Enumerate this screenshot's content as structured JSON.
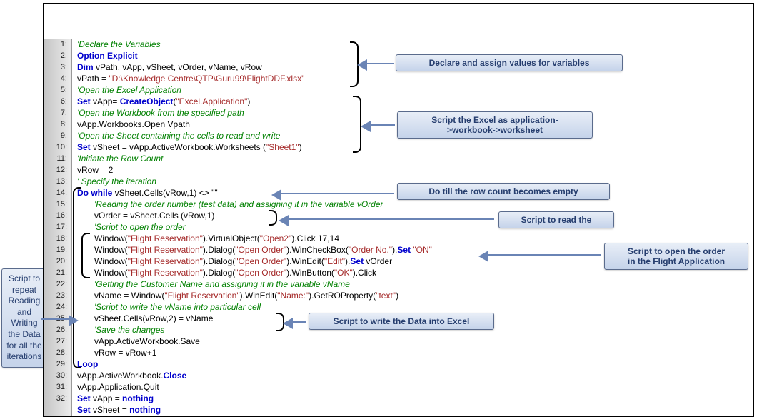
{
  "code": {
    "lines": [
      {
        "n": "1:",
        "indent": 0,
        "segs": [
          {
            "t": "'Declare the Variables",
            "c": "comment"
          }
        ]
      },
      {
        "n": "2:",
        "indent": 0,
        "segs": [
          {
            "t": "Option Explicit",
            "c": "kw"
          }
        ]
      },
      {
        "n": "3:",
        "indent": 0,
        "segs": [
          {
            "t": "Dim ",
            "c": "kw"
          },
          {
            "t": "vPath, vApp, vSheet, vOrder, vName, vRow",
            "c": "plain"
          }
        ]
      },
      {
        "n": "4:",
        "indent": 0,
        "segs": [
          {
            "t": "vPath = ",
            "c": "plain"
          },
          {
            "t": "\"D:\\Knowledge Centre\\QTP\\Guru99\\FlightDDF.xlsx\"",
            "c": "str"
          }
        ]
      },
      {
        "n": "5:",
        "indent": 0,
        "segs": [
          {
            "t": "'Open the Excel Application",
            "c": "comment"
          }
        ]
      },
      {
        "n": "6:",
        "indent": 0,
        "segs": [
          {
            "t": "Set ",
            "c": "kw"
          },
          {
            "t": "vApp= ",
            "c": "plain"
          },
          {
            "t": "CreateObject",
            "c": "kw"
          },
          {
            "t": "(",
            "c": "plain"
          },
          {
            "t": "\"Excel.Application\"",
            "c": "str"
          },
          {
            "t": ")",
            "c": "plain"
          }
        ]
      },
      {
        "n": "7:",
        "indent": 0,
        "segs": [
          {
            "t": "'Open the Workbook from the specified path",
            "c": "comment"
          }
        ]
      },
      {
        "n": "8:",
        "indent": 0,
        "segs": [
          {
            "t": "vApp.Workbooks.Open Vpath",
            "c": "plain"
          }
        ]
      },
      {
        "n": "9:",
        "indent": 0,
        "segs": [
          {
            "t": "'Open the Sheet containing the cells to read and write",
            "c": "comment"
          }
        ]
      },
      {
        "n": "10:",
        "indent": 0,
        "segs": [
          {
            "t": "Set ",
            "c": "kw"
          },
          {
            "t": "vSheet = vApp.ActiveWorkbook.Worksheets (",
            "c": "plain"
          },
          {
            "t": "\"Sheet1\"",
            "c": "str"
          },
          {
            "t": ")",
            "c": "plain"
          }
        ]
      },
      {
        "n": "11:",
        "indent": 0,
        "segs": [
          {
            "t": "'Initiate the Row Count",
            "c": "comment"
          }
        ]
      },
      {
        "n": "12:",
        "indent": 0,
        "segs": [
          {
            "t": "vRow = 2",
            "c": "plain"
          }
        ]
      },
      {
        "n": "13:",
        "indent": 0,
        "segs": [
          {
            "t": "' Specify the iteration",
            "c": "comment"
          }
        ]
      },
      {
        "n": "14:",
        "indent": 0,
        "segs": [
          {
            "t": "Do while ",
            "c": "kw"
          },
          {
            "t": "vSheet.Cells(vRow,1) <> \"\"",
            "c": "plain"
          }
        ]
      },
      {
        "n": "15:",
        "indent": 1,
        "segs": [
          {
            "t": "'Reading the order number (test data) and assigning it in the variable vOrder",
            "c": "comment"
          }
        ]
      },
      {
        "n": "16:",
        "indent": 1,
        "segs": [
          {
            "t": "vOrder = vSheet.Cells (vRow,1)",
            "c": "plain"
          }
        ]
      },
      {
        "n": "17:",
        "indent": 1,
        "segs": [
          {
            "t": "'Script to open the order",
            "c": "comment"
          }
        ]
      },
      {
        "n": "18:",
        "indent": 1,
        "segs": [
          {
            "t": "Window(",
            "c": "plain"
          },
          {
            "t": "\"Flight Reservation\"",
            "c": "str"
          },
          {
            "t": ").VirtualObject(",
            "c": "plain"
          },
          {
            "t": "\"Open2\"",
            "c": "str"
          },
          {
            "t": ").Click 17,14",
            "c": "plain"
          }
        ]
      },
      {
        "n": "19:",
        "indent": 1,
        "segs": [
          {
            "t": "Window(",
            "c": "plain"
          },
          {
            "t": "\"Flight Reservation\"",
            "c": "str"
          },
          {
            "t": ").Dialog(",
            "c": "plain"
          },
          {
            "t": "\"Open Order\"",
            "c": "str"
          },
          {
            "t": ").WinCheckBox(",
            "c": "plain"
          },
          {
            "t": "\"Order No.\"",
            "c": "str"
          },
          {
            "t": ").",
            "c": "plain"
          },
          {
            "t": "Set ",
            "c": "kw"
          },
          {
            "t": "\"ON\"",
            "c": "str"
          }
        ]
      },
      {
        "n": "20:",
        "indent": 1,
        "segs": [
          {
            "t": "Window(",
            "c": "plain"
          },
          {
            "t": "\"Flight Reservation\"",
            "c": "str"
          },
          {
            "t": ").Dialog(",
            "c": "plain"
          },
          {
            "t": "\"Open Order\"",
            "c": "str"
          },
          {
            "t": ").WinEdit(",
            "c": "plain"
          },
          {
            "t": "\"Edit\"",
            "c": "str"
          },
          {
            "t": ").",
            "c": "plain"
          },
          {
            "t": "Set ",
            "c": "kw"
          },
          {
            "t": "vOrder",
            "c": "plain"
          }
        ]
      },
      {
        "n": "21:",
        "indent": 1,
        "segs": [
          {
            "t": "Window(",
            "c": "plain"
          },
          {
            "t": "\"Flight Reservation\"",
            "c": "str"
          },
          {
            "t": ").Dialog(",
            "c": "plain"
          },
          {
            "t": "\"Open Order\"",
            "c": "str"
          },
          {
            "t": ").WinButton(",
            "c": "plain"
          },
          {
            "t": "\"OK\"",
            "c": "str"
          },
          {
            "t": ").Click",
            "c": "plain"
          }
        ]
      },
      {
        "n": "22:",
        "indent": 1,
        "segs": [
          {
            "t": "'Getting the Customer Name and assigning it in the variable vName",
            "c": "comment"
          }
        ]
      },
      {
        "n": "23:",
        "indent": 1,
        "segs": [
          {
            "t": "vName = Window(",
            "c": "plain"
          },
          {
            "t": "\"Flight Reservation\"",
            "c": "str"
          },
          {
            "t": ").WinEdit(",
            "c": "plain"
          },
          {
            "t": "\"Name:\"",
            "c": "str"
          },
          {
            "t": ").GetROProperty(",
            "c": "plain"
          },
          {
            "t": "\"text\"",
            "c": "str"
          },
          {
            "t": ")",
            "c": "plain"
          }
        ]
      },
      {
        "n": "24:",
        "indent": 1,
        "segs": [
          {
            "t": "'Script to write the vName into particular cell",
            "c": "comment"
          }
        ]
      },
      {
        "n": "25:",
        "indent": 1,
        "segs": [
          {
            "t": "vSheet.Cells(vRow,2) = vName",
            "c": "plain"
          }
        ]
      },
      {
        "n": "26:",
        "indent": 1,
        "segs": [
          {
            "t": "'Save the changes",
            "c": "comment"
          }
        ]
      },
      {
        "n": "27:",
        "indent": 1,
        "segs": [
          {
            "t": "vApp.ActiveWorkbook.Save",
            "c": "plain"
          }
        ]
      },
      {
        "n": "28:",
        "indent": 1,
        "segs": [
          {
            "t": "vRow = vRow+1",
            "c": "plain"
          }
        ]
      },
      {
        "n": "29:",
        "indent": 0,
        "segs": [
          {
            "t": "Loop",
            "c": "kw"
          }
        ]
      },
      {
        "n": "30:",
        "indent": 0,
        "segs": [
          {
            "t": "vApp.ActiveWorkbook.",
            "c": "plain"
          },
          {
            "t": "Close",
            "c": "kw"
          }
        ]
      },
      {
        "n": "31:",
        "indent": 0,
        "segs": [
          {
            "t": "vApp.Application.Quit",
            "c": "plain"
          }
        ]
      },
      {
        "n": "32:",
        "indent": 0,
        "segs": [
          {
            "t": "Set ",
            "c": "kw"
          },
          {
            "t": "vApp = ",
            "c": "plain"
          },
          {
            "t": "nothing",
            "c": "kw"
          }
        ]
      },
      {
        "n": "",
        "indent": 0,
        "segs": [
          {
            "t": "Set ",
            "c": "kw"
          },
          {
            "t": "vSheet = ",
            "c": "plain"
          },
          {
            "t": "nothing",
            "c": "kw"
          }
        ]
      }
    ]
  },
  "callouts": {
    "declare": "Declare and assign values for variables",
    "excel": "Script the Excel as application-\n>workbook->worksheet",
    "rowempty": "Do till the row count becomes empty",
    "read": "Script to read the",
    "openorder": "Script to open the order\nin the Flight Application",
    "write": "Script to write the Data into Excel",
    "repeat": "Script to\nrepeat\nReading\nand\nWriting\nthe Data\nfor all the\niterations"
  }
}
